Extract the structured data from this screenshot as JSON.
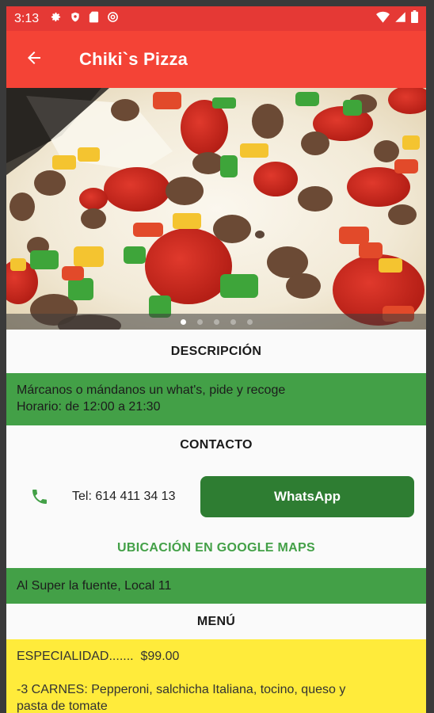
{
  "status_bar": {
    "time": "3:13",
    "icons": [
      "settings-icon",
      "shield-icon",
      "sd-card-icon",
      "at-icon"
    ],
    "right_icons": [
      "wifi-icon",
      "signal-icon",
      "battery-icon"
    ]
  },
  "app_bar": {
    "title": "Chiki`s Pizza",
    "back_icon": "arrow-back-icon"
  },
  "carousel": {
    "image": "pizza-photo",
    "page_count": 5,
    "active_index": 0
  },
  "description": {
    "title": "DESCRIPCIÓN",
    "line1": "Márcanos o mándanos un what's, pide y recoge",
    "line2": "Horario: de 12:00 a 21:30"
  },
  "contact": {
    "title": "CONTACTO",
    "phone_icon": "phone-icon",
    "phone": "Tel: 614 411 34 13",
    "whatsapp_label": "WhatsApp"
  },
  "location": {
    "maps_label": "UBICACIÓN EN GOOGLE MAPS",
    "address": "Al Super la fuente, Local 11"
  },
  "menu": {
    "title": "MENÚ",
    "specialty": "ESPECIALIDAD.......  $99.00",
    "item1_line1": "-3 CARNES: Pepperoni, salchicha Italiana, tocino, queso y",
    "item1_line2": "pasta de tomate"
  },
  "colors": {
    "status_bar": "#e53935",
    "app_bar": "#f44336",
    "green": "#43a047",
    "dark_green": "#2e7d32",
    "yellow": "#ffeb3b"
  }
}
